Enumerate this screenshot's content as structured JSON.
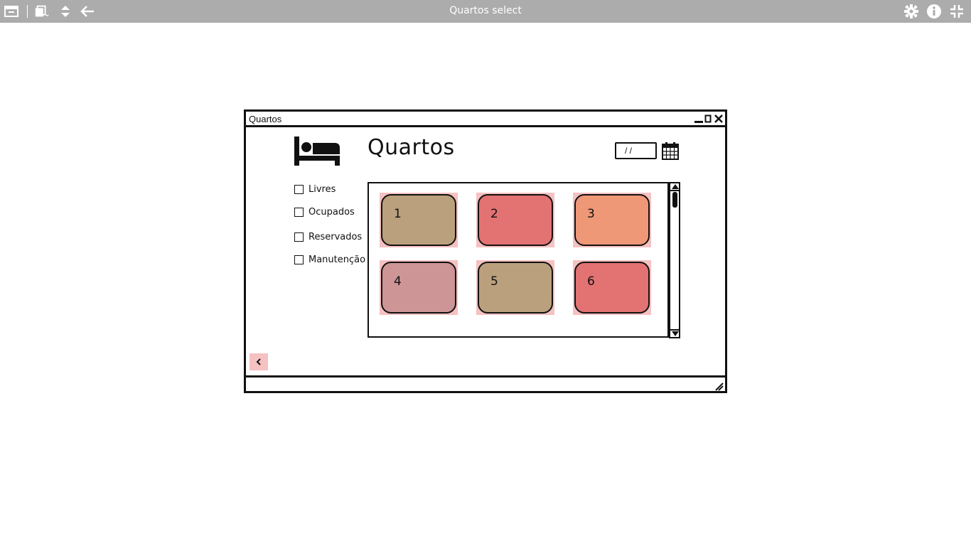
{
  "viewer": {
    "title": "Quartos select",
    "icons": [
      "window-icon",
      "pages-icon",
      "expand-collapse-icon",
      "back-arrow-icon",
      "gear-icon",
      "info-icon",
      "exit-fullscreen-icon"
    ]
  },
  "window": {
    "title": "Quartos",
    "controls": [
      "minimize-icon",
      "maximize-icon",
      "close-icon"
    ]
  },
  "page": {
    "heading": "Quartos",
    "header_icon": "bed-icon",
    "date_value": "/ /",
    "calendar_icon": "calendar-icon"
  },
  "filters": [
    {
      "label": "Livres",
      "checked": false
    },
    {
      "label": "Ocupados",
      "checked": false
    },
    {
      "label": "Reservados",
      "checked": false
    },
    {
      "label": "Manutenção",
      "checked": false
    }
  ],
  "rooms": [
    {
      "number": "1",
      "color": "#bba07e"
    },
    {
      "number": "2",
      "color": "#e37272"
    },
    {
      "number": "3",
      "color": "#ef9878"
    },
    {
      "number": "4",
      "color": "#cd9596"
    },
    {
      "number": "5",
      "color": "#bba07e"
    },
    {
      "number": "6",
      "color": "#e37272"
    }
  ],
  "colors": {
    "viewer_bar": "#acacac",
    "highlight": "#f5c1c1"
  },
  "back_button_icon": "chevron-left-icon"
}
